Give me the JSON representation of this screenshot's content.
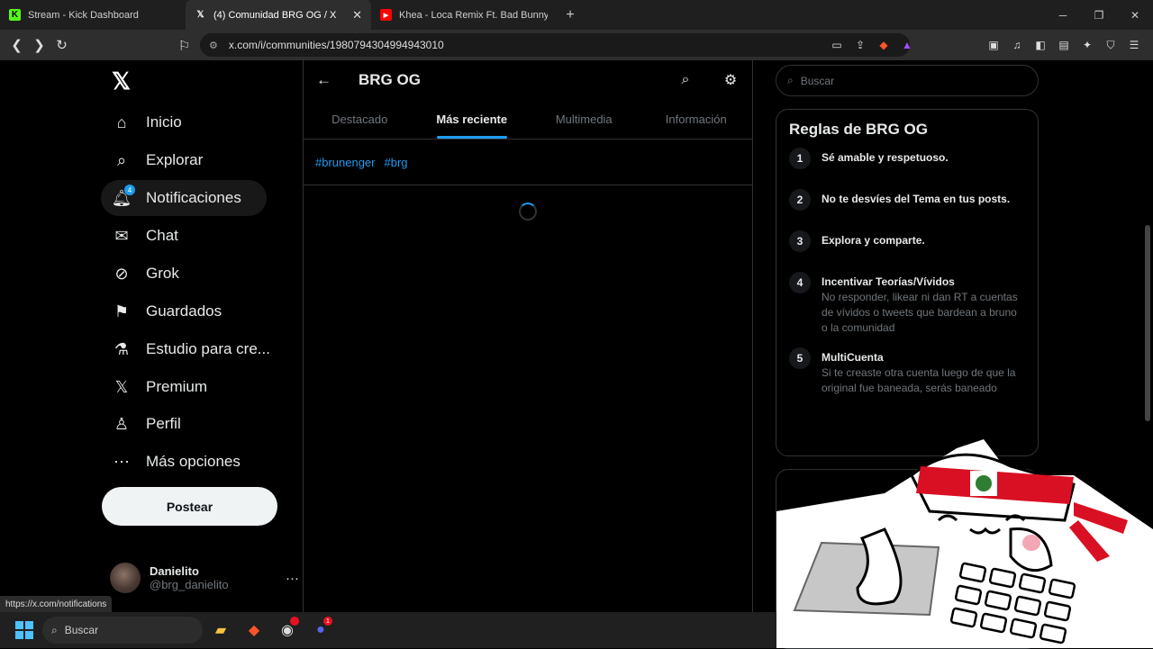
{
  "browser": {
    "tabs": [
      {
        "title": "Stream - Kick Dashboard",
        "icon": "kick-icon",
        "color": "#53fc18"
      },
      {
        "title": "(4) Comunidad BRG OG / X",
        "icon": "x-icon",
        "color": "#ffffff"
      },
      {
        "title": "Khea - Loca Remix Ft. Bad Bunny, Du",
        "icon": "youtube-icon",
        "color": "#ff0000"
      }
    ],
    "url": "x.com/i/communities/1980794304994943010"
  },
  "nav": {
    "items": [
      {
        "label": "Inicio",
        "icon": "home-icon"
      },
      {
        "label": "Explorar",
        "icon": "search-icon"
      },
      {
        "label": "Notificaciones",
        "icon": "bell-icon",
        "badge": "4"
      },
      {
        "label": "Chat",
        "icon": "mail-icon"
      },
      {
        "label": "Grok",
        "icon": "grok-icon"
      },
      {
        "label": "Guardados",
        "icon": "bookmark-icon"
      },
      {
        "label": "Estudio para cre...",
        "icon": "flask-icon"
      },
      {
        "label": "Premium",
        "icon": "x-logo-icon"
      },
      {
        "label": "Perfil",
        "icon": "person-icon"
      },
      {
        "label": "Más opciones",
        "icon": "more-circle-icon"
      }
    ],
    "post_label": "Postear",
    "account": {
      "name": "Danielito",
      "handle": "@brg_danielito"
    }
  },
  "main": {
    "title": "BRG OG",
    "tabs": [
      "Destacado",
      "Más reciente",
      "Multimedia",
      "Información"
    ],
    "selected_tab": "Más reciente",
    "tags": [
      "#brunenger",
      "#brg"
    ]
  },
  "right": {
    "search_placeholder": "Buscar",
    "rules_title": "Reglas de BRG OG",
    "rules": [
      {
        "num": "1",
        "title": "Sé amable y respetuoso.",
        "desc": ""
      },
      {
        "num": "2",
        "title": "No te desvíes del Tema en tus posts.",
        "desc": ""
      },
      {
        "num": "3",
        "title": "Explora y comparte.",
        "desc": ""
      },
      {
        "num": "4",
        "title": "Incentivar Teorías/Vívidos",
        "desc": "No responder, likear ni dan RT a cuentas de vívidos o tweets que bardean a bruno o la comunidad"
      },
      {
        "num": "5",
        "title": "MultiCuenta",
        "desc": "Si te creaste otra cuenta luego de que la original fue baneada, serás baneado"
      }
    ]
  },
  "status_link": "https://x.com/notifications",
  "taskbar": {
    "search_label": "Buscar",
    "discord_badge": "1"
  },
  "colors": {
    "accent": "#1d9bf0",
    "background": "#000000",
    "border": "#2f3336"
  }
}
